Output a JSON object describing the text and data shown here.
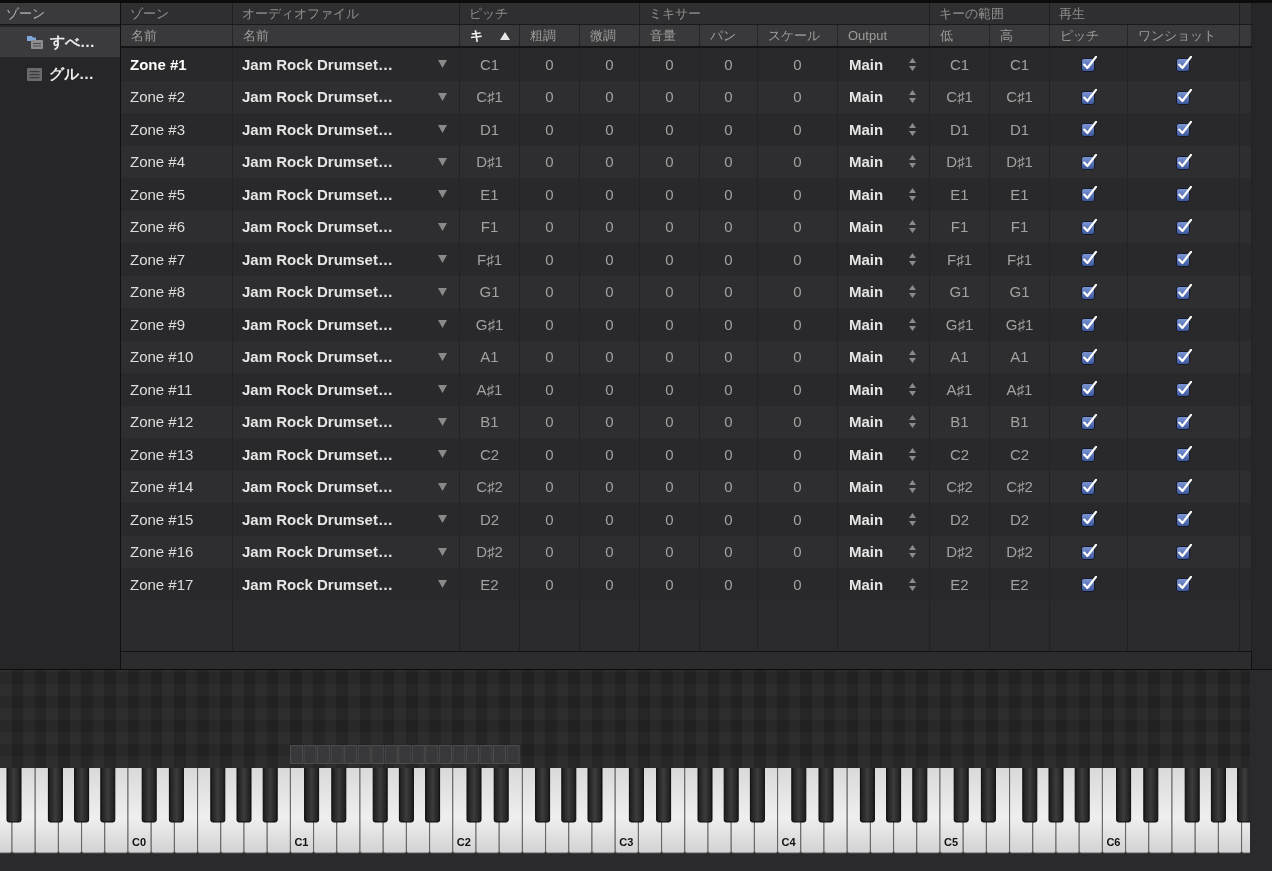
{
  "sidebar": {
    "header": "ゾーン",
    "items": [
      {
        "kind": "all",
        "label": "すべ…",
        "selected": true
      },
      {
        "kind": "group",
        "label": "グル…",
        "selected": false
      }
    ]
  },
  "table": {
    "groups": [
      {
        "label": "ゾーン",
        "columns": [
          {
            "label": "名前",
            "sorted": false
          }
        ]
      },
      {
        "label": "オーディオファイル",
        "columns": [
          {
            "label": "名前",
            "sorted": false
          }
        ]
      },
      {
        "label": "ピッチ",
        "columns": [
          {
            "label": "キ",
            "sorted": true
          },
          {
            "label": "粗調",
            "sorted": false
          },
          {
            "label": "微調",
            "sorted": false
          }
        ]
      },
      {
        "label": "ミキサー",
        "columns": [
          {
            "label": "音量",
            "sorted": false
          },
          {
            "label": "パン",
            "sorted": false
          },
          {
            "label": "スケール",
            "sorted": false
          },
          {
            "label": "Output",
            "sorted": false
          }
        ]
      },
      {
        "label": "キーの範囲",
        "columns": [
          {
            "label": "低",
            "sorted": false
          },
          {
            "label": "高",
            "sorted": false
          }
        ]
      },
      {
        "label": "再生",
        "columns": [
          {
            "label": "ピッチ",
            "sorted": false
          },
          {
            "label": "ワンショット",
            "sorted": false
          }
        ]
      }
    ],
    "rows": [
      {
        "name": "Zone #1",
        "selected": true,
        "file": "Jam Rock Drumset…",
        "key": "C1",
        "coarse": "0",
        "fine": "0",
        "volume": "0",
        "pan": "0",
        "scale": "0",
        "output": "Main",
        "low": "C1",
        "high": "C1",
        "pitch": true,
        "one_shot": true
      },
      {
        "name": "Zone #2",
        "selected": false,
        "file": "Jam Rock Drumset…",
        "key": "C♯1",
        "coarse": "0",
        "fine": "0",
        "volume": "0",
        "pan": "0",
        "scale": "0",
        "output": "Main",
        "low": "C♯1",
        "high": "C♯1",
        "pitch": true,
        "one_shot": true
      },
      {
        "name": "Zone #3",
        "selected": false,
        "file": "Jam Rock Drumset…",
        "key": "D1",
        "coarse": "0",
        "fine": "0",
        "volume": "0",
        "pan": "0",
        "scale": "0",
        "output": "Main",
        "low": "D1",
        "high": "D1",
        "pitch": true,
        "one_shot": true
      },
      {
        "name": "Zone #4",
        "selected": false,
        "file": "Jam Rock Drumset…",
        "key": "D♯1",
        "coarse": "0",
        "fine": "0",
        "volume": "0",
        "pan": "0",
        "scale": "0",
        "output": "Main",
        "low": "D♯1",
        "high": "D♯1",
        "pitch": true,
        "one_shot": true
      },
      {
        "name": "Zone #5",
        "selected": false,
        "file": "Jam Rock Drumset…",
        "key": "E1",
        "coarse": "0",
        "fine": "0",
        "volume": "0",
        "pan": "0",
        "scale": "0",
        "output": "Main",
        "low": "E1",
        "high": "E1",
        "pitch": true,
        "one_shot": true
      },
      {
        "name": "Zone #6",
        "selected": false,
        "file": "Jam Rock Drumset…",
        "key": "F1",
        "coarse": "0",
        "fine": "0",
        "volume": "0",
        "pan": "0",
        "scale": "0",
        "output": "Main",
        "low": "F1",
        "high": "F1",
        "pitch": true,
        "one_shot": true
      },
      {
        "name": "Zone #7",
        "selected": false,
        "file": "Jam Rock Drumset…",
        "key": "F♯1",
        "coarse": "0",
        "fine": "0",
        "volume": "0",
        "pan": "0",
        "scale": "0",
        "output": "Main",
        "low": "F♯1",
        "high": "F♯1",
        "pitch": true,
        "one_shot": true
      },
      {
        "name": "Zone #8",
        "selected": false,
        "file": "Jam Rock Drumset…",
        "key": "G1",
        "coarse": "0",
        "fine": "0",
        "volume": "0",
        "pan": "0",
        "scale": "0",
        "output": "Main",
        "low": "G1",
        "high": "G1",
        "pitch": true,
        "one_shot": true
      },
      {
        "name": "Zone #9",
        "selected": false,
        "file": "Jam Rock Drumset…",
        "key": "G♯1",
        "coarse": "0",
        "fine": "0",
        "volume": "0",
        "pan": "0",
        "scale": "0",
        "output": "Main",
        "low": "G♯1",
        "high": "G♯1",
        "pitch": true,
        "one_shot": true
      },
      {
        "name": "Zone #10",
        "selected": false,
        "file": "Jam Rock Drumset…",
        "key": "A1",
        "coarse": "0",
        "fine": "0",
        "volume": "0",
        "pan": "0",
        "scale": "0",
        "output": "Main",
        "low": "A1",
        "high": "A1",
        "pitch": true,
        "one_shot": true
      },
      {
        "name": "Zone #11",
        "selected": false,
        "file": "Jam Rock Drumset…",
        "key": "A♯1",
        "coarse": "0",
        "fine": "0",
        "volume": "0",
        "pan": "0",
        "scale": "0",
        "output": "Main",
        "low": "A♯1",
        "high": "A♯1",
        "pitch": true,
        "one_shot": true
      },
      {
        "name": "Zone #12",
        "selected": false,
        "file": "Jam Rock Drumset…",
        "key": "B1",
        "coarse": "0",
        "fine": "0",
        "volume": "0",
        "pan": "0",
        "scale": "0",
        "output": "Main",
        "low": "B1",
        "high": "B1",
        "pitch": true,
        "one_shot": true
      },
      {
        "name": "Zone #13",
        "selected": false,
        "file": "Jam Rock Drumset…",
        "key": "C2",
        "coarse": "0",
        "fine": "0",
        "volume": "0",
        "pan": "0",
        "scale": "0",
        "output": "Main",
        "low": "C2",
        "high": "C2",
        "pitch": true,
        "one_shot": true
      },
      {
        "name": "Zone #14",
        "selected": false,
        "file": "Jam Rock Drumset…",
        "key": "C♯2",
        "coarse": "0",
        "fine": "0",
        "volume": "0",
        "pan": "0",
        "scale": "0",
        "output": "Main",
        "low": "C♯2",
        "high": "C♯2",
        "pitch": true,
        "one_shot": true
      },
      {
        "name": "Zone #15",
        "selected": false,
        "file": "Jam Rock Drumset…",
        "key": "D2",
        "coarse": "0",
        "fine": "0",
        "volume": "0",
        "pan": "0",
        "scale": "0",
        "output": "Main",
        "low": "D2",
        "high": "D2",
        "pitch": true,
        "one_shot": true
      },
      {
        "name": "Zone #16",
        "selected": false,
        "file": "Jam Rock Drumset…",
        "key": "D♯2",
        "coarse": "0",
        "fine": "0",
        "volume": "0",
        "pan": "0",
        "scale": "0",
        "output": "Main",
        "low": "D♯2",
        "high": "D♯2",
        "pitch": true,
        "one_shot": true
      },
      {
        "name": "Zone #17",
        "selected": false,
        "file": "Jam Rock Drumset…",
        "key": "E2",
        "coarse": "0",
        "fine": "0",
        "volume": "0",
        "pan": "0",
        "scale": "0",
        "output": "Main",
        "low": "E2",
        "high": "E2",
        "pitch": true,
        "one_shot": true
      }
    ]
  },
  "keyboard": {
    "octave_labels": [
      "C0",
      "C1",
      "C2",
      "C3",
      "C4",
      "C5",
      "C6"
    ]
  }
}
